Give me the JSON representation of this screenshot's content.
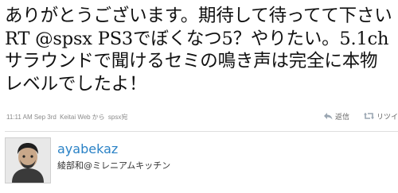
{
  "tweet": {
    "text_part1": "ありがとうございます。期待して待ってて下さい RT ",
    "mention": "@spsx",
    "text_part2": " PS3でぼくなつ5？やりたい。5.1chサラウンドで聞けるセミの鳴き声は完全に本物レベルでしたよ！"
  },
  "meta": {
    "time": "11:11 AM Sep 3rd",
    "source": "Keitai Web",
    "from_text": "から",
    "reply_to": "spsx宛"
  },
  "actions": {
    "reply_label": "返信",
    "retweet_label": "リツイ"
  },
  "user": {
    "screen_name": "ayabekaz",
    "full_name": "綾部和@ミレニアムキッチン"
  }
}
